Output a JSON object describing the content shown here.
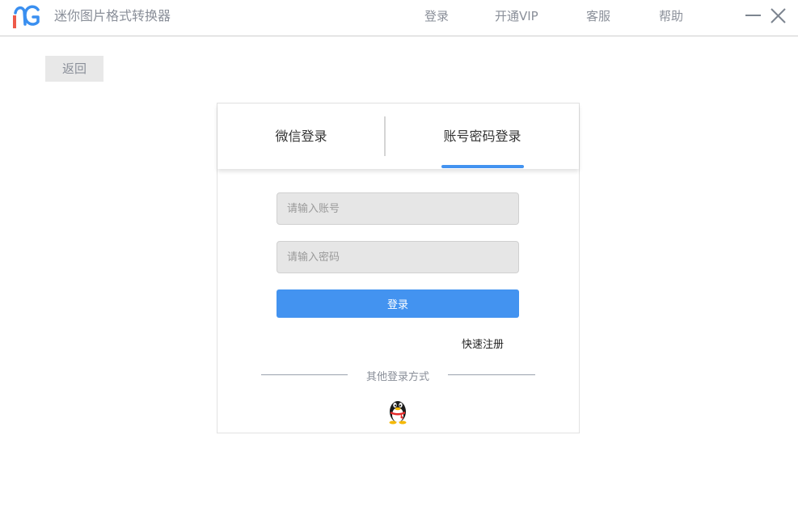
{
  "app": {
    "title": "迷你图片格式转换器"
  },
  "nav": {
    "login": "登录",
    "vip": "开通VIP",
    "service": "客服",
    "help": "帮助"
  },
  "back": {
    "label": "返回"
  },
  "tabs": [
    {
      "label": "微信登录",
      "active": false
    },
    {
      "label": "账号密码登录",
      "active": true
    }
  ],
  "form": {
    "account_placeholder": "请输入账号",
    "account_value": "",
    "password_placeholder": "请输入密码",
    "password_value": "",
    "submit_label": "登录",
    "register_label": "快速注册",
    "other_login_label": "其他登录方式"
  },
  "icons": {
    "logo": "app-logo-icon",
    "minimize": "minimize-icon",
    "close": "close-icon",
    "qq": "qq-penguin-icon"
  },
  "colors": {
    "accent": "#4393f0",
    "logo_red": "#ee5a4a",
    "logo_blue": "#3a8ff0",
    "text_muted": "#8a8f99"
  }
}
